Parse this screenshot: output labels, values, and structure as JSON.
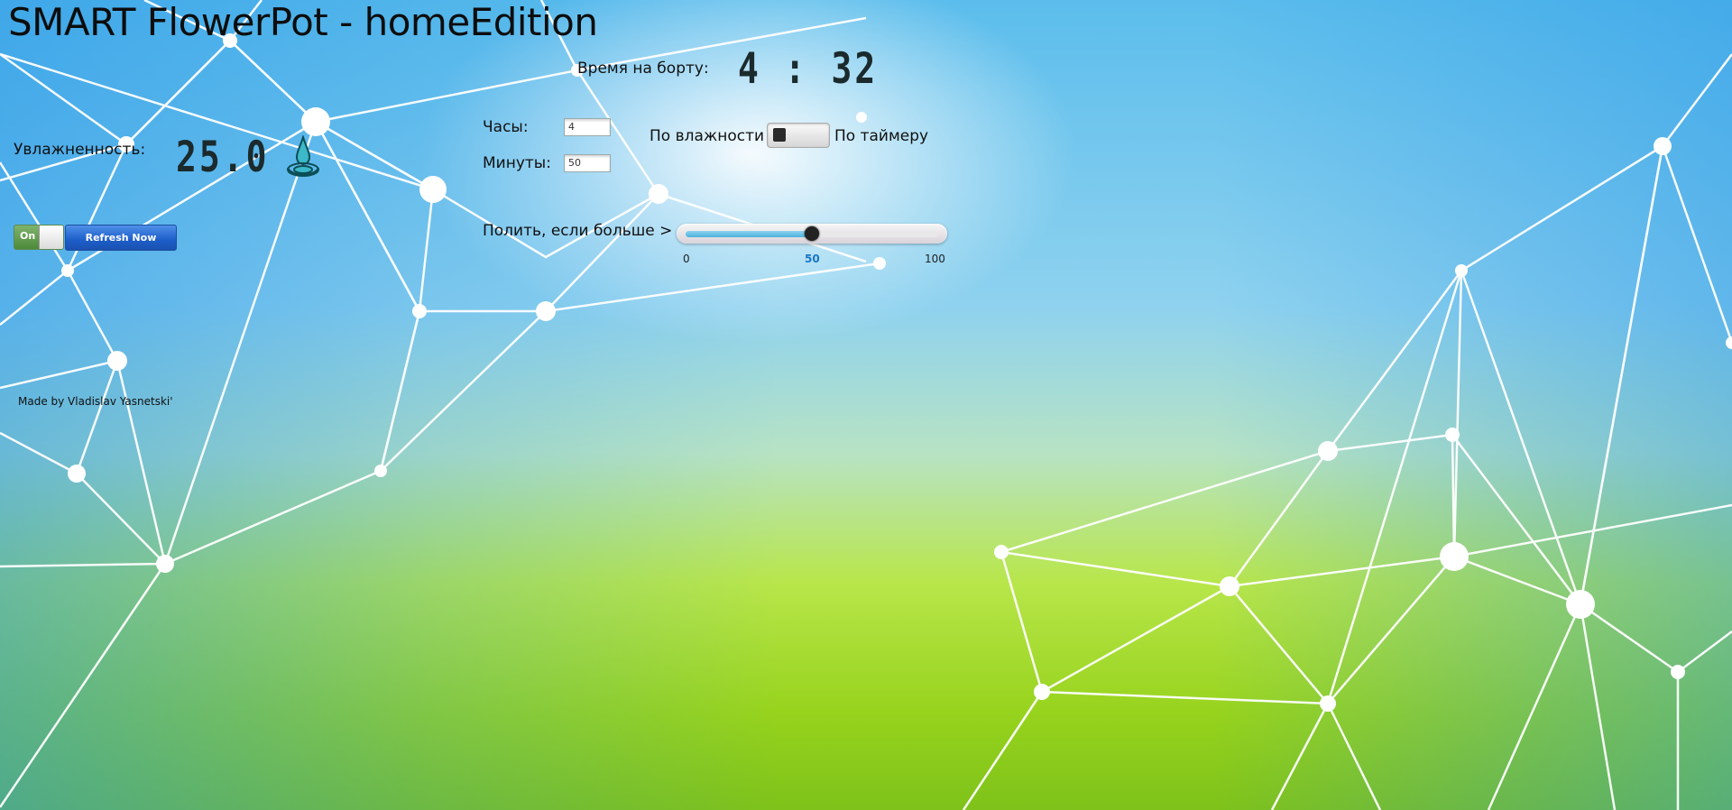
{
  "app": {
    "title": "SMART FlowerPot - homeEdition"
  },
  "clock": {
    "label": "Время на борту:",
    "value": "4 : 32"
  },
  "humidity": {
    "label": "Увлажненность:",
    "value": "25.0",
    "icon": "water-drop-icon"
  },
  "controls": {
    "onoff_label": "On",
    "refresh_label": "Refresh Now"
  },
  "timer": {
    "hours_label": "Часы:",
    "hours_value": "4",
    "minutes_label": "Минуты:",
    "minutes_value": "50"
  },
  "mode": {
    "left_label": "По влажности",
    "right_label": "По таймеру",
    "selected": "По влажности"
  },
  "threshold": {
    "label": "Полить, если больше >",
    "min": "0",
    "value": "50",
    "max": "100",
    "fill_fraction": 0.5
  },
  "footer": {
    "credit": "Made by Vladislav Yasnetski'"
  },
  "colors": {
    "accent": "#1d5ec9",
    "on_green": "#4e8a3a",
    "slider_fill": "#4bb2dc"
  }
}
